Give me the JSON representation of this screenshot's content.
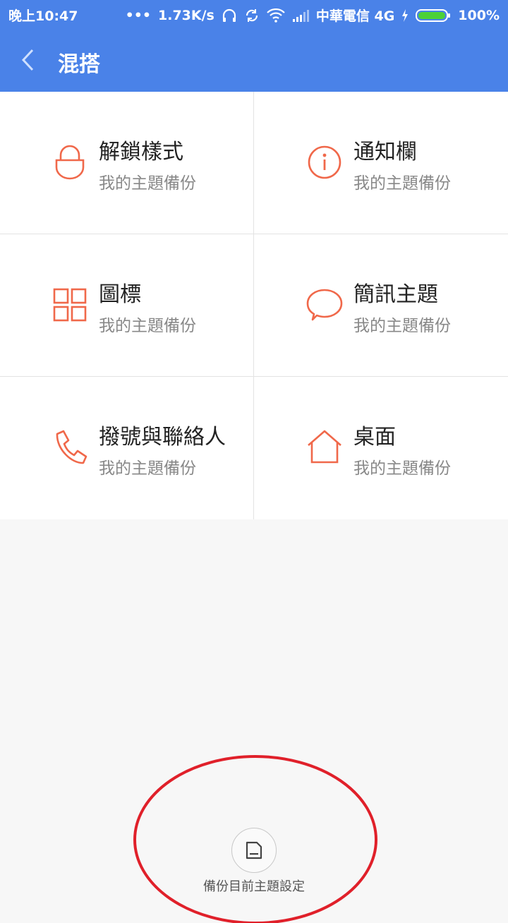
{
  "status": {
    "time": "晚上10:47",
    "speed": "1.73K/s",
    "carrier": "中華電信 4G",
    "battery": "100%"
  },
  "header": {
    "title": "混搭"
  },
  "items": [
    {
      "label": "解鎖樣式",
      "sub": "我的主題備份",
      "icon": "lock-icon"
    },
    {
      "label": "通知欄",
      "sub": "我的主題備份",
      "icon": "info-icon"
    },
    {
      "label": "圖標",
      "sub": "我的主題備份",
      "icon": "grid-icon"
    },
    {
      "label": "簡訊主題",
      "sub": "我的主題備份",
      "icon": "chat-bubble-icon"
    },
    {
      "label": "撥號與聯絡人",
      "sub": "我的主題備份",
      "icon": "phone-icon"
    },
    {
      "label": "桌面",
      "sub": "我的主題備份",
      "icon": "home-icon"
    }
  ],
  "footer": {
    "backup_label": "備份目前主題設定"
  },
  "colors": {
    "accent": "#4a82e8",
    "icon": "#f0684a",
    "annotation": "#e0202a"
  }
}
